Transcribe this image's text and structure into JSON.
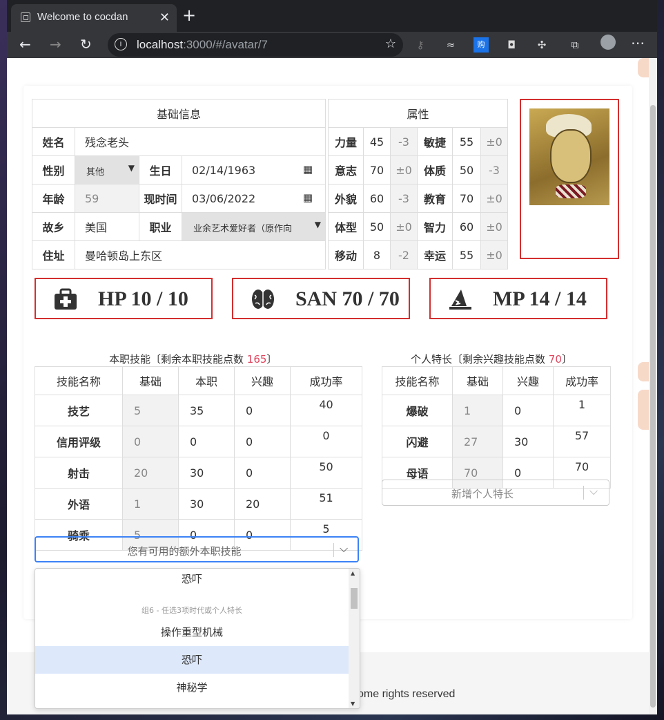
{
  "browser": {
    "tab_title": "Welcome to cocdan",
    "url_host": "localhost",
    "url_rest": ":3000/#/avatar/7"
  },
  "basic": {
    "header": "基础信息",
    "name_label": "姓名",
    "name_value": "残念老头",
    "gender_label": "性别",
    "gender_value": "其他",
    "birthday_label": "生日",
    "birthday_value": "02/14/1963",
    "age_label": "年龄",
    "age_value": "59",
    "now_label": "现时间",
    "now_value": "03/06/2022",
    "hometown_label": "故乡",
    "hometown_value": "美国",
    "job_label": "职业",
    "job_value": "业余艺术爱好者（原作向",
    "address_label": "住址",
    "address_value": "曼哈顿岛上东区"
  },
  "attributes": {
    "header": "属性",
    "rows": [
      {
        "a_label": "力量",
        "a_value": "45",
        "a_mod": "-3",
        "b_label": "敏捷",
        "b_value": "55",
        "b_mod": "±0"
      },
      {
        "a_label": "意志",
        "a_value": "70",
        "a_mod": "±0",
        "b_label": "体质",
        "b_value": "50",
        "b_mod": "-3"
      },
      {
        "a_label": "外貌",
        "a_value": "60",
        "a_mod": "-3",
        "b_label": "教育",
        "b_value": "70",
        "b_mod": "±0"
      },
      {
        "a_label": "体型",
        "a_value": "50",
        "a_mod": "±0",
        "b_label": "智力",
        "b_value": "60",
        "b_mod": "±0"
      },
      {
        "a_label": "移动",
        "a_value": "8",
        "a_mod": "-2",
        "b_label": "幸运",
        "b_value": "55",
        "b_mod": "±0"
      }
    ]
  },
  "stats": {
    "hp": "HP 10 / 10",
    "san": "SAN 70 / 70",
    "mp": "MP 14 / 14"
  },
  "occupation_skills": {
    "caption_prefix": "本职技能〔剩余本职技能点数 ",
    "points": "165",
    "caption_suffix": "〕",
    "headers": [
      "技能名称",
      "基础",
      "本职",
      "兴趣",
      "成功率"
    ],
    "rows": [
      {
        "name": "技艺",
        "base": "5",
        "occ": "35",
        "interest": "0",
        "rate": "40"
      },
      {
        "name": "信用评级",
        "base": "0",
        "occ": "0",
        "interest": "0",
        "rate": "0"
      },
      {
        "name": "射击",
        "base": "20",
        "occ": "30",
        "interest": "0",
        "rate": "50"
      },
      {
        "name": "外语",
        "base": "1",
        "occ": "30",
        "interest": "20",
        "rate": "51"
      },
      {
        "name": "骑乘",
        "base": "5",
        "occ": "0",
        "interest": "0",
        "rate": "5"
      }
    ],
    "select_placeholder": "您有可用的额外本职技能"
  },
  "personal_skills": {
    "caption_prefix": "个人特长〔剩余兴趣技能点数 ",
    "points": "70",
    "caption_suffix": "〕",
    "headers": [
      "技能名称",
      "基础",
      "兴趣",
      "成功率"
    ],
    "rows": [
      {
        "name": "爆破",
        "base": "1",
        "interest": "0",
        "rate": "1"
      },
      {
        "name": "闪避",
        "base": "27",
        "interest": "30",
        "rate": "57"
      },
      {
        "name": "母语",
        "base": "70",
        "interest": "0",
        "rate": "70"
      }
    ],
    "select_placeholder": "新增个人特长"
  },
  "dropdown": {
    "item_top": "恐吓",
    "group_label": "组6 - 任选3项时代或个人特长",
    "item_1": "操作重型机械",
    "item_2": "恐吓",
    "item_3": "神秘学"
  },
  "footer": {
    "text": "ome rights reserved"
  },
  "colors": {
    "accent_red": "#d32f2f",
    "points_red": "#e0455e",
    "focus_blue": "#3b82f6",
    "selected_option": "#dde8fb"
  }
}
